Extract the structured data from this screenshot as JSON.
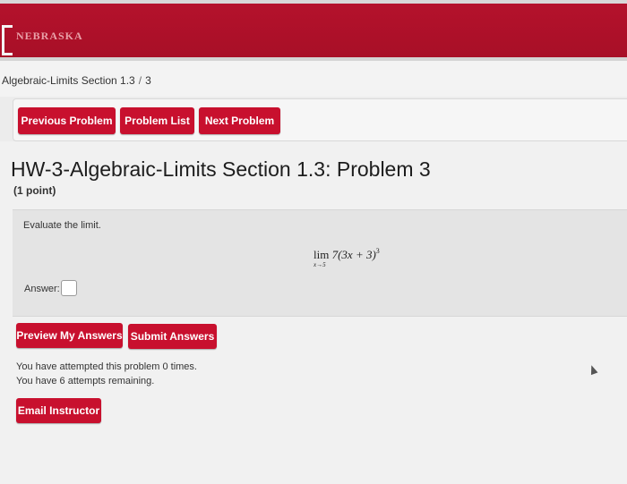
{
  "header": {
    "brand": "NEBRASKA",
    "accent_color": "#c8102e"
  },
  "breadcrumb": {
    "course": "Algebraic-Limits Section 1.3",
    "separator": "/",
    "problem": "3"
  },
  "nav": {
    "previous_label": "Previous Problem",
    "list_label": "Problem List",
    "next_label": "Next Problem"
  },
  "problem": {
    "title": "HW-3-Algebraic-Limits Section 1.3: Problem 3",
    "points": "(1 point)",
    "instruction": "Evaluate the limit.",
    "limit_word": "lim",
    "limit_subscript": "x→5",
    "expression": "7(3x + 3)",
    "exponent": "3",
    "answer_label": "Answer:",
    "answer_value": ""
  },
  "actions": {
    "preview_label": "Preview My Answers",
    "submit_label": "Submit Answers"
  },
  "status": {
    "attempted": "You have attempted this problem 0 times.",
    "remaining": "You have 6 attempts remaining."
  },
  "footer": {
    "email_label": "Email Instructor"
  },
  "icons": [
    "nebraska-n-logo-icon",
    "mouse-cursor-icon"
  ]
}
